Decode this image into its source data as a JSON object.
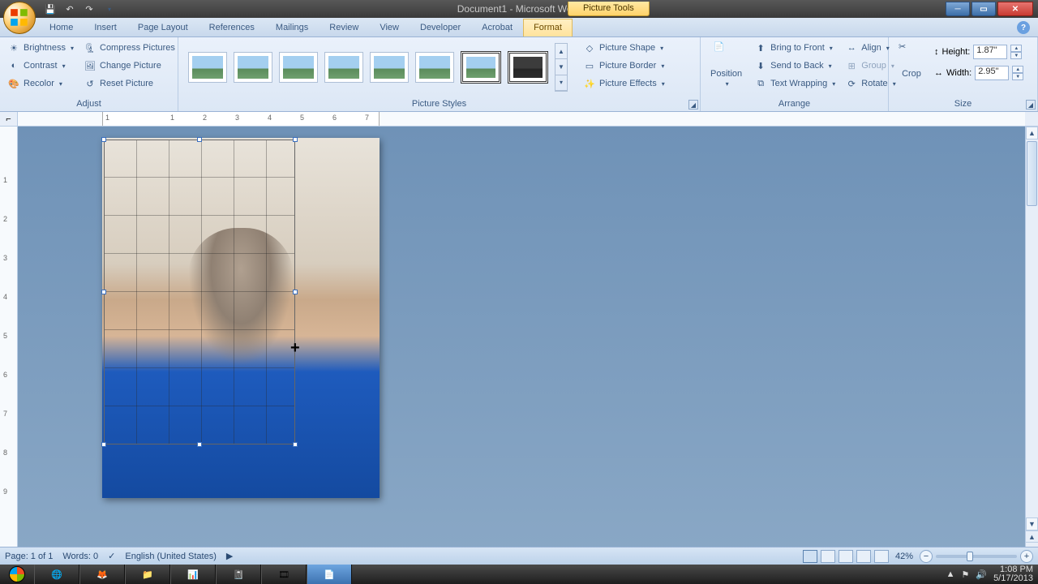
{
  "title": "Document1 - Microsoft Word",
  "context_tab": "Picture Tools",
  "tabs": [
    "Home",
    "Insert",
    "Page Layout",
    "References",
    "Mailings",
    "Review",
    "View",
    "Developer",
    "Acrobat",
    "Format"
  ],
  "active_tab": "Format",
  "adjust": {
    "label": "Adjust",
    "brightness": "Brightness",
    "contrast": "Contrast",
    "recolor": "Recolor",
    "compress": "Compress Pictures",
    "change": "Change Picture",
    "reset": "Reset Picture"
  },
  "picture_styles": {
    "label": "Picture Styles",
    "shape": "Picture Shape",
    "border": "Picture Border",
    "effects": "Picture Effects"
  },
  "arrange": {
    "label": "Arrange",
    "position": "Position",
    "bring_front": "Bring to Front",
    "send_back": "Send to Back",
    "wrap": "Text Wrapping",
    "align": "Align",
    "group": "Group",
    "rotate": "Rotate"
  },
  "size": {
    "label": "Size",
    "crop": "Crop",
    "height_label": "Height:",
    "height": "1.87\"",
    "width_label": "Width:",
    "width": "2.95\""
  },
  "ruler_marks": [
    "1",
    "",
    "1",
    "",
    "2",
    "",
    "3",
    "",
    "4",
    "",
    "5",
    "",
    "6",
    "",
    "7"
  ],
  "vruler_marks": [
    "",
    "1",
    "",
    "2",
    "",
    "3",
    "",
    "4",
    "",
    "5",
    "",
    "6",
    "",
    "7",
    "",
    "8",
    "",
    "9"
  ],
  "status": {
    "page": "Page: 1 of 1",
    "words": "Words: 0",
    "lang": "English (United States)",
    "zoom": "42%"
  },
  "tray": {
    "time": "1:08 PM",
    "date": "5/17/2013"
  }
}
